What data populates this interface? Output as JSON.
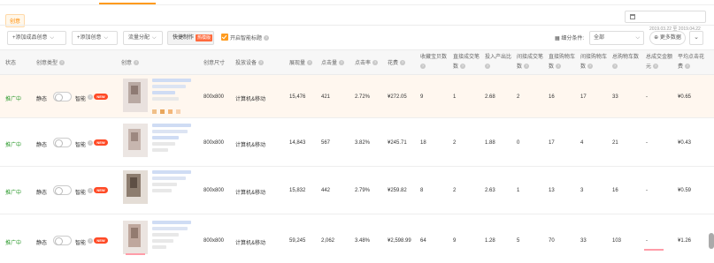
{
  "tab": {
    "title": "创意"
  },
  "toolbar": {
    "add_creative": "+添加成品创意",
    "add_creative2": "+添加创意",
    "traffic_split": "流量分配",
    "quick_make": "快捷制作",
    "hot_badge": "热模版",
    "smart_title": "开启智能标题"
  },
  "filters": {
    "date_range": "2019.03.22 至 2019.04.22",
    "scope_label": "细分条件:",
    "scope_value": "全部",
    "more_data": "更多数据"
  },
  "columns": [
    "状态",
    "创意类型",
    "创意",
    "创意尺寸",
    "投放设备",
    "展现量",
    "点击量",
    "点击率",
    "花费",
    "收藏宝贝数",
    "直接成交笔数",
    "投入产出比",
    "间接成交笔数",
    "直接购物车数",
    "间接购物车数",
    "总购物车数",
    "总成交金额",
    "平均点击花费"
  ],
  "col_headers": {
    "status": "状态",
    "type": "创意类型",
    "creative": "创意",
    "size": "创意尺寸",
    "device": "投放设备",
    "impressions": "展现量",
    "clicks": "点击量",
    "ctr": "点击率",
    "cost": "花费",
    "fav": "收藏宝贝数",
    "direct_orders_1": "直接成交笔",
    "direct_orders_2": "数",
    "roi": "投入产出比",
    "indirect_orders_1": "间接成交笔",
    "indirect_orders_2": "数",
    "direct_cart_1": "直接购物车",
    "direct_cart_2": "数",
    "indirect_cart_1": "间接购物车",
    "indirect_cart_2": "数",
    "total_cart": "总购物车数",
    "gmv_1": "总成交金额",
    "gmv_2": "元",
    "cpc_1": "平均点击花",
    "cpc_2": "费"
  },
  "labels": {
    "static": "静态",
    "smart": "智能",
    "new_badge": "NEW"
  },
  "rows": [
    {
      "status": "推广中",
      "size": "800x800",
      "device": "计算机&移动",
      "impressions": "15,476",
      "clicks": "421",
      "ctr": "2.72%",
      "cost": "¥272.05",
      "fav": "9",
      "direct_orders": "1",
      "roi": "2.68",
      "indirect_orders": "2",
      "direct_cart": "16",
      "indirect_cart": "17",
      "total_cart": "33",
      "gmv": "-",
      "cpc": "¥0.65"
    },
    {
      "status": "推广中",
      "size": "800x800",
      "device": "计算机&移动",
      "impressions": "14,843",
      "clicks": "567",
      "ctr": "3.82%",
      "cost": "¥245.71",
      "fav": "18",
      "direct_orders": "2",
      "roi": "1.88",
      "indirect_orders": "0",
      "direct_cart": "17",
      "indirect_cart": "4",
      "total_cart": "21",
      "gmv": "-",
      "cpc": "¥0.43"
    },
    {
      "status": "推广中",
      "size": "800x800",
      "device": "计算机&移动",
      "impressions": "15,832",
      "clicks": "442",
      "ctr": "2.79%",
      "cost": "¥259.82",
      "fav": "8",
      "direct_orders": "2",
      "roi": "2.63",
      "indirect_orders": "1",
      "direct_cart": "13",
      "indirect_cart": "3",
      "total_cart": "16",
      "gmv": "-",
      "cpc": "¥0.59"
    },
    {
      "status": "推广中",
      "size": "800x800",
      "device": "计算机&移动",
      "impressions": "59,245",
      "clicks": "2,062",
      "ctr": "3.48%",
      "cost": "¥2,598.99",
      "fav": "64",
      "direct_orders": "9",
      "roi": "1.28",
      "indirect_orders": "5",
      "direct_cart": "70",
      "indirect_cart": "33",
      "total_cart": "103",
      "gmv": "-",
      "cpc": "¥1.26"
    }
  ],
  "colors": {
    "accent": "#ff9b1e",
    "status_green": "#2d9a2d",
    "new_badge": "#ff4a26",
    "row_highlight": "#fff7ef"
  }
}
